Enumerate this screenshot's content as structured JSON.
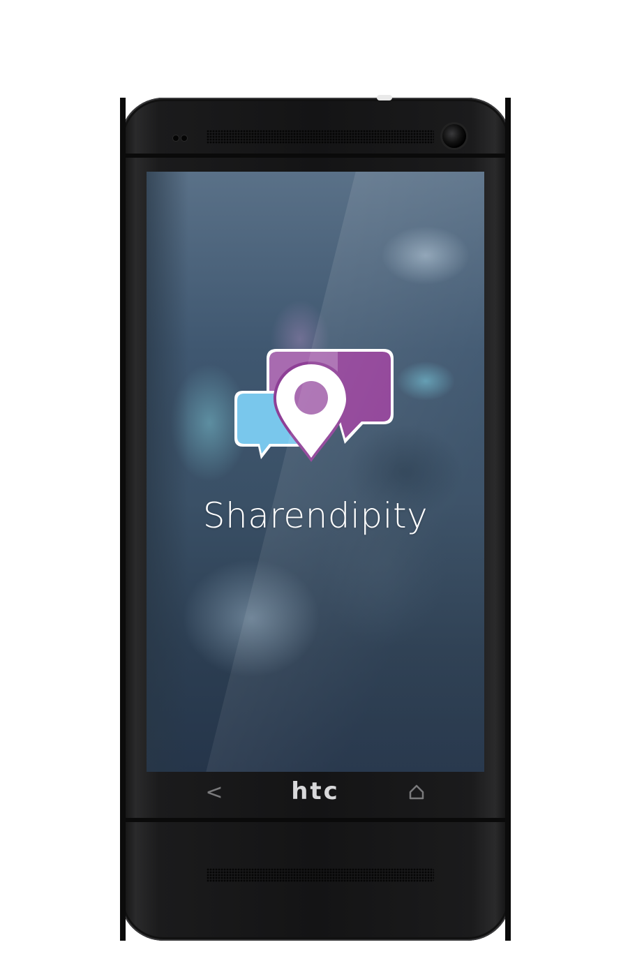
{
  "device": {
    "brand_label": "htc"
  },
  "app": {
    "name": "Sharendipity",
    "logo_icon": "map-pin-chat-bubbles-icon"
  },
  "navigation": {
    "back_icon": "back-chevron-icon",
    "back_glyph": "<",
    "home_icon": "home-icon"
  },
  "colors": {
    "purple_bubble": "#8e3f96",
    "light_purple": "#a86bb0",
    "blue_bubble": "#79c7ec",
    "pin_fill": "#ffffff",
    "pin_dot": "#a86bb0"
  }
}
